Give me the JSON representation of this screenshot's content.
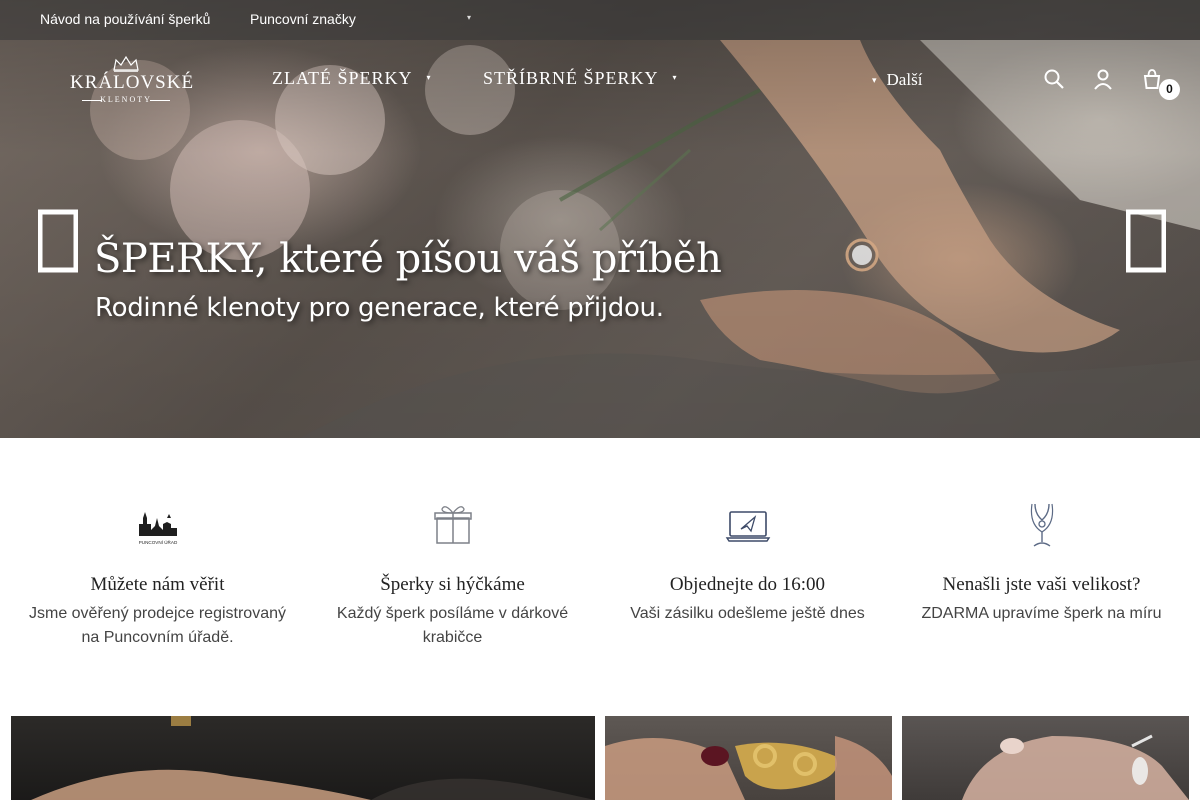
{
  "topbar": {
    "links": [
      {
        "label": "Návod na používání šperků"
      },
      {
        "label": "Puncovní značky"
      }
    ]
  },
  "logo": {
    "name": "KRÁLOVSKÉ",
    "sub": "KLENOTY"
  },
  "nav": {
    "items": [
      {
        "label": "ZLATÉ ŠPERKY"
      },
      {
        "label": "STŘÍBRNÉ ŠPERKY"
      }
    ],
    "more_label": "Další"
  },
  "header_icons": {
    "search": "search-icon",
    "account": "user-icon",
    "cart": "cart-icon",
    "cart_count": "0"
  },
  "hero": {
    "title": "ŠPERKY, které píšou váš příběh",
    "subtitle": "Rodinné klenoty pro generace, které přijdou."
  },
  "features": [
    {
      "icon": "puncovni-urad-icon",
      "icon_caption": "PUNCOVNÍ ÚŘAD",
      "title": "Můžete nám věřit",
      "desc": "Jsme ověřený prodejce registrovaný na Puncovním úřadě."
    },
    {
      "icon": "gift-box-icon",
      "title": "Šperky si hýčkáme",
      "desc": "Každý šperk posíláme v dárkové krabičce"
    },
    {
      "icon": "laptop-send-icon",
      "title": "Objednejte do 16:00",
      "desc": "Vaši zásilku odešleme ještě dnes"
    },
    {
      "icon": "necklace-bust-icon",
      "title": "Nenašli jste vaši velikost?",
      "desc": "ZDARMA upravíme šperk na míru"
    }
  ],
  "colors": {
    "accent_text": "#222222",
    "topbar_bg": "rgba(55,55,55,0.55)",
    "icon_blue": "#3d4a68"
  }
}
